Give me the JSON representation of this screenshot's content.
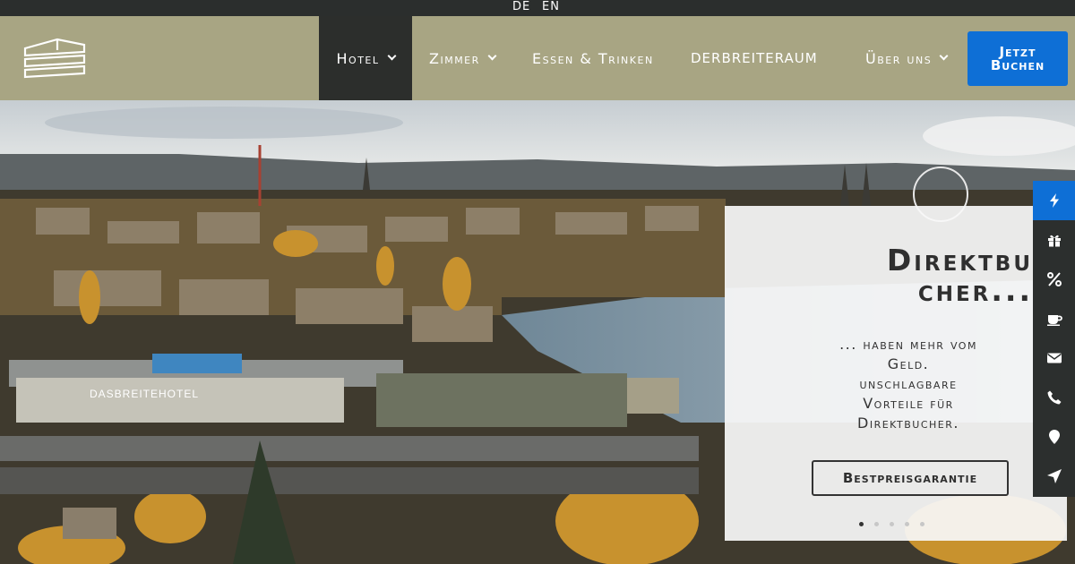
{
  "languages": [
    "DE",
    "EN"
  ],
  "nav": {
    "items": [
      {
        "label": "Hotel",
        "dropdown": true,
        "active": true
      },
      {
        "label": "Zimmer",
        "dropdown": true
      },
      {
        "label": "Essen & Trinken",
        "dropdown": false
      },
      {
        "label": "DERBREITERAUM",
        "dropdown": false
      },
      {
        "label": "Über uns",
        "dropdown": true
      }
    ],
    "book_label_line1": "Jetzt",
    "book_label_line2": "Buchen"
  },
  "hero": {
    "building_sign": "DASBREITEHOTEL"
  },
  "slide": {
    "title_line1": "Direktbu",
    "title_line2": "cher...",
    "text_line1": "... haben mehr vom",
    "text_line2": "Geld.",
    "text_line3": "unschlagbare",
    "text_line4": "Vorteile für",
    "text_line5": "Direktbucher.",
    "button_label": "Bestpreisgarantie",
    "slide_count": 5,
    "active_slide": 1
  },
  "sidebar": {
    "icons": [
      "bolt-icon",
      "gift-icon",
      "percent-icon",
      "coffee-icon",
      "envelope-icon",
      "phone-icon",
      "map-pin-icon",
      "navigation-icon"
    ]
  },
  "colors": {
    "navbar": "#a8a583",
    "dark": "#2c2f2e",
    "accent": "#0e6fd6"
  }
}
